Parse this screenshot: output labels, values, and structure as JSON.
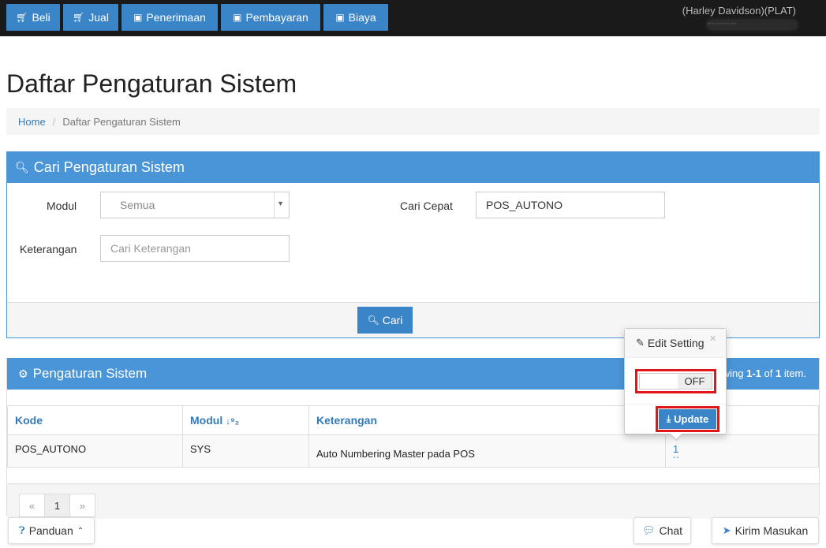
{
  "topnav": {
    "buttons": [
      {
        "label": "Beli",
        "icon": "cart-icon"
      },
      {
        "label": "Jual",
        "icon": "cart-icon"
      },
      {
        "label": "Penerimaan",
        "icon": "money-icon"
      },
      {
        "label": "Pembayaran",
        "icon": "money-icon"
      },
      {
        "label": "Biaya",
        "icon": "money-icon"
      }
    ],
    "store_name": "(Harley Davidson)(PLAT)",
    "user_email": "••••••••••••"
  },
  "page_title": "Daftar Pengaturan Sistem",
  "breadcrumb": {
    "home": "Home",
    "current": "Daftar Pengaturan Sistem"
  },
  "search_panel": {
    "title": "Cari Pengaturan Sistem",
    "modul_label": "Modul",
    "modul_value": "Semua",
    "keterangan_label": "Keterangan",
    "keterangan_placeholder": "Cari Keterangan",
    "cari_cepat_label": "Cari Cepat",
    "cari_cepat_value": "POS_AUTONO",
    "search_button": "Cari"
  },
  "list_panel": {
    "title": "Pengaturan Sistem",
    "summary_prefix": "wing ",
    "summary_range": "1-1",
    "summary_of": " of ",
    "summary_total": "1",
    "summary_suffix": " item.",
    "columns": [
      "Kode",
      "Modul",
      "Keterangan"
    ],
    "rows": [
      {
        "kode": "POS_AUTONO",
        "modul": "SYS",
        "keterangan": "Auto Numbering Master pada POS",
        "nilai": "1",
        "nilai_sub": "--"
      }
    ],
    "pagination": {
      "prev": "«",
      "page": "1",
      "next": "»"
    }
  },
  "popover": {
    "title": "Edit Setting",
    "close": "×",
    "toggle_state": "OFF",
    "update_button": "Update"
  },
  "footer": {
    "panduan": "Panduan",
    "chat": "Chat",
    "feedback": "Kirim Masukan"
  },
  "colors": {
    "primary": "#3a84c8",
    "panel_header": "#4a95d8",
    "highlight": "#e0161b",
    "topbar": "#1a1a1a"
  }
}
